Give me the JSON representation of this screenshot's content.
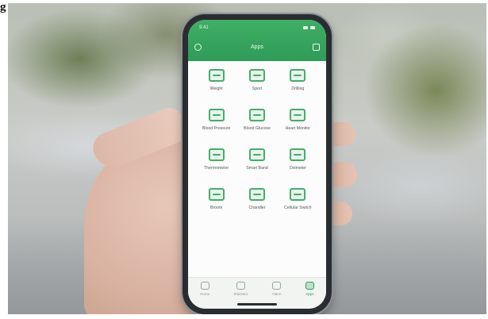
{
  "corner_text": "g",
  "phone": {
    "status": {
      "time": "9:41"
    },
    "app_title": "Apps",
    "grid_items": [
      {
        "label": "Weight",
        "icon": "scale-icon"
      },
      {
        "label": "Sport",
        "icon": "sport-icon"
      },
      {
        "label": "Drilling",
        "icon": "drill-icon"
      },
      {
        "label": "Blood Pressure",
        "icon": "heart-icon"
      },
      {
        "label": "Blood Glucose",
        "icon": "glucose-icon"
      },
      {
        "label": "Heart Monitor",
        "icon": "monitor-icon"
      },
      {
        "label": "Thermometer",
        "icon": "thermometer-icon"
      },
      {
        "label": "Smart Band",
        "icon": "band-icon"
      },
      {
        "label": "Oximeter",
        "icon": "oximeter-icon"
      },
      {
        "label": "Broom",
        "icon": "broom-icon"
      },
      {
        "label": "Chandler",
        "icon": "lamp-icon"
      },
      {
        "label": "Cellular Switch",
        "icon": "switch-icon"
      }
    ],
    "tabs": [
      {
        "label": "Home",
        "icon": "home-icon",
        "active": false
      },
      {
        "label": "Statistics",
        "icon": "stats-icon",
        "active": false
      },
      {
        "label": "Alarm",
        "icon": "alarm-icon",
        "active": false
      },
      {
        "label": "Apps",
        "icon": "apps-icon",
        "active": true
      }
    ]
  },
  "colors": {
    "accent": "#2f9c57",
    "icon": "#45ad6a",
    "skin": "#e2bfae"
  }
}
